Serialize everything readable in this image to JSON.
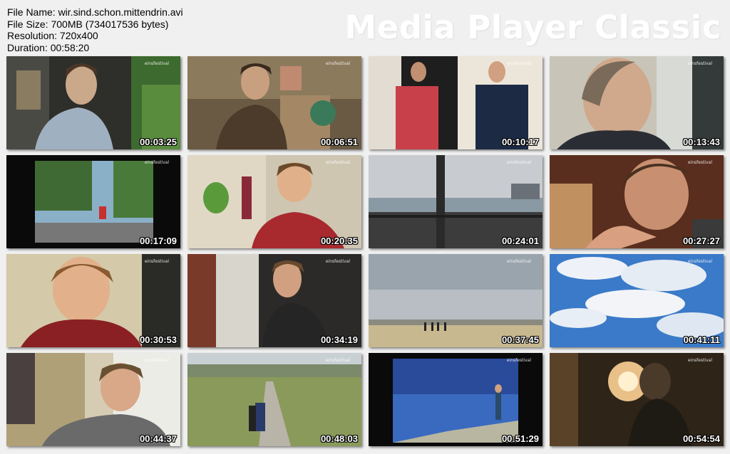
{
  "info": {
    "file_name": "File Name: wir.sind.schon.mittendrin.avi",
    "file_size": "File Size: 700MB (734017536 bytes)",
    "resolution": "Resolution: 720x400",
    "duration": "Duration: 00:58:20"
  },
  "brand": "Media Player Classic",
  "logo_text": "einsfestival",
  "thumbnails": [
    {
      "time": "00:03:25"
    },
    {
      "time": "00:06:51"
    },
    {
      "time": "00:10:17"
    },
    {
      "time": "00:13:43"
    },
    {
      "time": "00:17:09"
    },
    {
      "time": "00:20:35"
    },
    {
      "time": "00:24:01"
    },
    {
      "time": "00:27:27"
    },
    {
      "time": "00:30:53"
    },
    {
      "time": "00:34:19"
    },
    {
      "time": "00:37:45"
    },
    {
      "time": "00:41:11"
    },
    {
      "time": "00:44:37"
    },
    {
      "time": "00:48:03"
    },
    {
      "time": "00:51:29"
    },
    {
      "time": "00:54:54"
    }
  ]
}
